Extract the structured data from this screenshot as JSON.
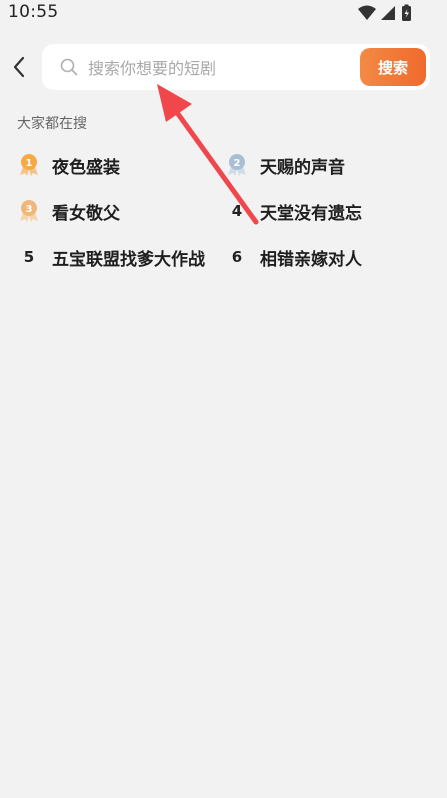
{
  "status_bar": {
    "time": "10:55"
  },
  "search": {
    "placeholder": "搜索你想要的短剧",
    "button_label": "搜索"
  },
  "hot_section": {
    "title": "大家都在搜",
    "items": [
      {
        "rank": "1",
        "label": "夜色盛装",
        "badge": "gold"
      },
      {
        "rank": "2",
        "label": "天赐的声音",
        "badge": "silver"
      },
      {
        "rank": "3",
        "label": "看女敬父",
        "badge": "bronze"
      },
      {
        "rank": "4",
        "label": "天堂没有遗忘",
        "badge": ""
      },
      {
        "rank": "5",
        "label": "五宝联盟找爹大作战",
        "badge": ""
      },
      {
        "rank": "6",
        "label": "相错亲嫁对人",
        "badge": ""
      }
    ]
  },
  "colors": {
    "accent": "#ef6a2d",
    "annotation": "#f0474d",
    "background": "#f2f2f2"
  }
}
